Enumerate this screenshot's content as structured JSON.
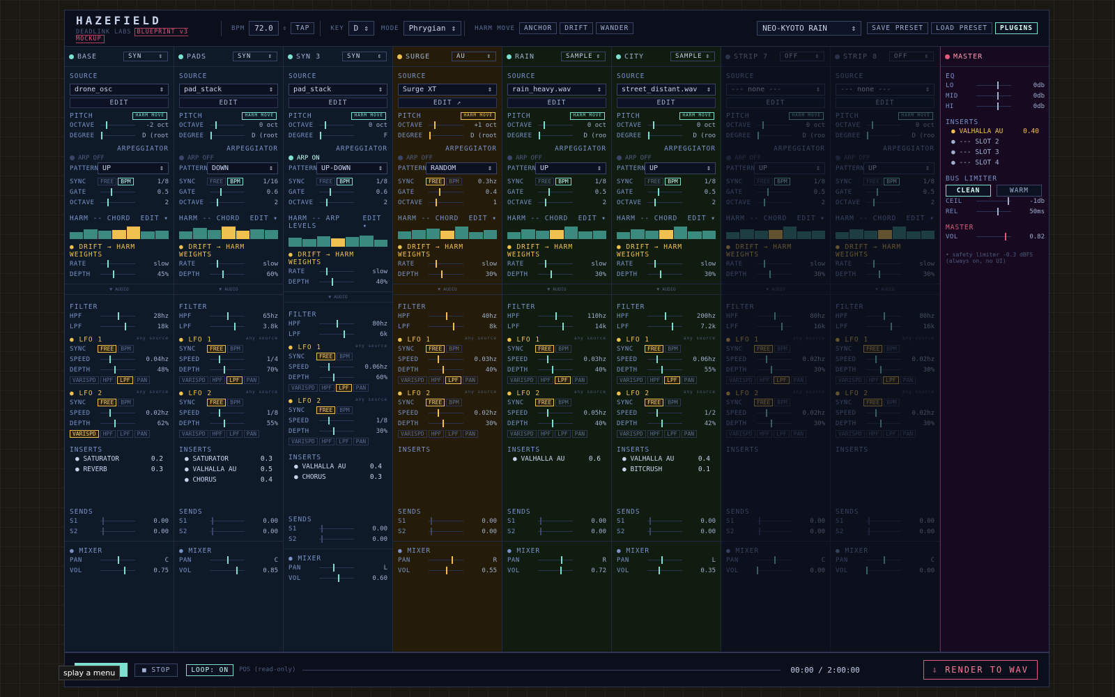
{
  "brand": {
    "title": "HAZEFIELD",
    "sub": "DEADLINK LABS",
    "badge": "BLUEPRINT v3 MOCKUP"
  },
  "header": {
    "bpm_label": "BPM",
    "bpm": "72.0",
    "tap": "TAP",
    "key_label": "KEY",
    "key": "D",
    "mode_label": "MODE",
    "mode": "Phrygian",
    "harm_label": "HARM MOVE",
    "harm_opts": [
      "ANCHOR",
      "DRIFT",
      "WANDER"
    ],
    "preset": "NEO-KYOTO RAIN",
    "save": "SAVE PRESET",
    "load": "LOAD PRESET",
    "plugins": "PLUGINS"
  },
  "strips": [
    {
      "name": "BASE",
      "type": "SYN",
      "source": "drone_osc",
      "oct": "-2 oct",
      "deg": "D (root",
      "arp": "ARP OFF",
      "pattern": "UP",
      "rate": "1/8",
      "gate": "0.5",
      "aoct": "2",
      "harm": "HARM -- CHORD",
      "bars": [
        6,
        10,
        8,
        9,
        14,
        7,
        8
      ],
      "drift_rate": "slow",
      "drift_depth": "45%",
      "hpf": "28hz",
      "lpf": "18k",
      "l1s": "0.04hz",
      "l1d": "48%",
      "l2s": "0.02hz",
      "l2d": "62%",
      "ins": [
        [
          "SATURATOR",
          "0.2"
        ],
        [
          "REVERB",
          "0.3"
        ]
      ],
      "pan": "C",
      "vol": "0.75"
    },
    {
      "name": "PADS",
      "type": "SYN",
      "source": "pad_stack",
      "oct": "0 oct",
      "deg": "D (root",
      "arp": "ARP OFF",
      "pattern": "DOWN",
      "rate": "1/16",
      "gate": "0.6",
      "aoct": "2",
      "harm": "HARM -- CHORD",
      "bars": [
        7,
        12,
        9,
        14,
        8,
        10,
        9
      ],
      "drift_rate": "slow",
      "drift_depth": "60%",
      "hpf": "65hz",
      "lpf": "3.8k",
      "l1s": "1/4",
      "l1d": "70%",
      "l2s": "1/8",
      "l2d": "55%",
      "ins": [
        [
          "SATURATOR",
          "0.3"
        ],
        [
          "VALHALLA AU",
          "0.5"
        ],
        [
          "CHORUS",
          "0.4"
        ]
      ],
      "pan": "C",
      "vol": "0.85"
    },
    {
      "name": "SYN 3",
      "type": "SYN",
      "source": "pad_stack",
      "oct": "0 oct",
      "deg": "F",
      "arp": "ARP ON",
      "pattern": "UP-DOWN",
      "rate": "1/8",
      "gate": "0.6",
      "aoct": "2",
      "harm": "HARM -- ARP LEVELS",
      "bars": [
        9,
        7,
        11,
        8,
        10,
        12,
        6
      ],
      "drift_rate": "slow",
      "drift_depth": "40%",
      "hpf": "80hz",
      "lpf": "6k",
      "l1s": "0.06hz",
      "l1d": "60%",
      "l2s": "1/8",
      "l2d": "30%",
      "ins": [
        [
          "VALHALLA AU",
          "0.4"
        ],
        [
          "CHORUS",
          "0.3"
        ]
      ],
      "pan": "L",
      "vol": "0.60"
    },
    {
      "name": "SURGE",
      "type": "AU",
      "source": "Surge XT",
      "oct": "+1 oct",
      "deg": "D (root",
      "arp": "ARP OFF",
      "pattern": "RANDOM",
      "rate": "0.3hz",
      "gate": "0.4",
      "aoct": "1",
      "harm": "HARM -- CHORD",
      "bars": [
        7,
        9,
        11,
        8,
        14,
        6,
        9
      ],
      "drift_rate": "slow",
      "drift_depth": "30%",
      "hpf": "40hz",
      "lpf": "8k",
      "l1s": "0.03hz",
      "l1d": "40%",
      "l2s": "0.02hz",
      "l2d": "30%",
      "ins": [],
      "pan": "R",
      "vol": "0.55"
    },
    {
      "name": "RAIN",
      "type": "SAMPLE",
      "source": "rain_heavy.wav",
      "oct": "0 oct",
      "deg": "D (roo",
      "arp": "ARP OFF",
      "pattern": "UP",
      "rate": "1/8",
      "gate": "0.5",
      "aoct": "2",
      "harm": "HARM -- CHORD",
      "bars": [
        6,
        10,
        8,
        9,
        14,
        7,
        8
      ],
      "drift_rate": "slow",
      "drift_depth": "30%",
      "hpf": "110hz",
      "lpf": "14k",
      "l1s": "0.03hz",
      "l1d": "40%",
      "l2s": "0.05hz",
      "l2d": "40%",
      "ins": [
        [
          "VALHALLA AU",
          "0.6"
        ]
      ],
      "pan": "R",
      "vol": "0.72"
    },
    {
      "name": "CITY",
      "type": "SAMPLE",
      "source": "street_distant.wav",
      "oct": "0 oct",
      "deg": "D (roo",
      "arp": "ARP OFF",
      "pattern": "UP",
      "rate": "1/8",
      "gate": "0.5",
      "aoct": "2",
      "harm": "HARM -- CHORD",
      "bars": [
        6,
        10,
        8,
        9,
        14,
        7,
        8
      ],
      "drift_rate": "slow",
      "drift_depth": "30%",
      "hpf": "200hz",
      "lpf": "7.2k",
      "l1s": "0.06hz",
      "l1d": "55%",
      "l2s": "1/2",
      "l2d": "42%",
      "ins": [
        [
          "VALHALLA AU",
          "0.4"
        ],
        [
          "BITCRUSH",
          "0.1"
        ]
      ],
      "pan": "L",
      "vol": "0.35"
    },
    {
      "name": "STRIP 7",
      "type": "OFF",
      "source": "--- none ---",
      "oct": "0 oct",
      "deg": "D (roo",
      "arp": "ARP OFF",
      "pattern": "UP",
      "rate": "1/8",
      "gate": "0.5",
      "aoct": "2",
      "harm": "HARM -- CHORD",
      "bars": [
        6,
        10,
        8,
        9,
        14,
        7,
        8
      ],
      "drift_rate": "slow",
      "drift_depth": "30%",
      "hpf": "80hz",
      "lpf": "16k",
      "l1s": "0.02hz",
      "l1d": "30%",
      "l2s": "0.02hz",
      "l2d": "30%",
      "ins": [],
      "pan": "C",
      "vol": "0.00"
    },
    {
      "name": "STRIP 8",
      "type": "OFF",
      "source": "--- none ---",
      "oct": "0 oct",
      "deg": "D (roo",
      "arp": "ARP OFF",
      "pattern": "UP",
      "rate": "1/8",
      "gate": "0.5",
      "aoct": "2",
      "harm": "HARM -- CHORD",
      "bars": [
        6,
        10,
        8,
        9,
        14,
        7,
        8
      ],
      "drift_rate": "slow",
      "drift_depth": "30%",
      "hpf": "80hz",
      "lpf": "16k",
      "l1s": "0.02hz",
      "l1d": "30%",
      "l2s": "0.02hz",
      "l2d": "30%",
      "ins": [],
      "pan": "C",
      "vol": "0.00"
    }
  ],
  "labels": {
    "source": "SOURCE",
    "edit": "EDIT",
    "pitch": "PITCH",
    "octave": "OCTAVE",
    "degree": "DEGREE",
    "arpeggiator": "ARPEGGIATOR",
    "pattern": "PATTERN",
    "sync": "SYNC",
    "gate": "GATE",
    "drift": "DRIFT → HARM WEIGHTS",
    "rate": "RATE",
    "depth": "DEPTH",
    "audio": "▼ AUDIO",
    "filter": "FILTER",
    "hpf": "HPF",
    "lpf": "LPF",
    "lfo1": "LFO 1",
    "lfo2": "LFO 2",
    "any": "any source",
    "speed": "SPEED",
    "inserts": "INSERTS",
    "sends": "SENDS",
    "mixer": "MIXER",
    "pan": "PAN",
    "vol": "VOL",
    "free": "FREE",
    "bpm": "BPM",
    "harm_move": "HARM MOVE",
    "edit_caret": "EDIT ▾",
    "targets": [
      "VARISPD",
      "HPF",
      "LPF",
      "PAN",
      "VOL"
    ]
  },
  "master": {
    "name": "MASTER",
    "eq": "EQ",
    "eq_rows": [
      [
        "LO",
        "0db"
      ],
      [
        "MID",
        "0db"
      ],
      [
        "HI",
        "0db"
      ]
    ],
    "inserts": "INSERTS",
    "ins": [
      [
        "VALHALLA AU",
        "0.40"
      ],
      [
        "--- SLOT 2",
        ""
      ],
      [
        "--- SLOT 3",
        ""
      ],
      [
        "--- SLOT 4",
        ""
      ]
    ],
    "limiter": "BUS LIMITER",
    "clean": "CLEAN",
    "warm": "WARM",
    "ceil": "-1db",
    "rel": "50ms",
    "ceil_l": "CEIL",
    "rel_l": "REL",
    "vol_l": "MASTER",
    "vol": "0.82",
    "note": "• safety limiter -0.3 dBFS (always on, no UI)"
  },
  "footer": {
    "stop": "■ STOP",
    "loop": "LOOP: ON",
    "pos": "POS (read-only)",
    "time": "00:00 / 2:00:00",
    "render": "⇩ RENDER TO WAV",
    "tooltip": "splay a menu"
  },
  "colors": {
    "accent": "#7ee0d0",
    "gold": "#f0c050",
    "master": "#e05a7c"
  }
}
